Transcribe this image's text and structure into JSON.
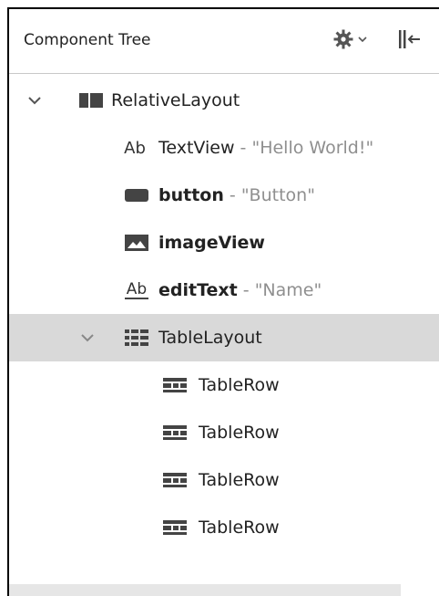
{
  "header": {
    "title": "Component Tree"
  },
  "tree": {
    "relative_layout": {
      "name": "RelativeLayout"
    },
    "text_view": {
      "name": "TextView",
      "sep": " - ",
      "value": "\"Hello World!\"",
      "icon_text": "Ab"
    },
    "button": {
      "name": "button",
      "sep": " - ",
      "value": "\"Button\""
    },
    "image_view": {
      "name": "imageView"
    },
    "edit_text": {
      "name": "editText",
      "sep": " - ",
      "value": "\"Name\"",
      "icon_text": "Ab"
    },
    "table_layout": {
      "name": "TableLayout"
    },
    "table_rows": [
      {
        "name": "TableRow"
      },
      {
        "name": "TableRow"
      },
      {
        "name": "TableRow"
      },
      {
        "name": "TableRow"
      }
    ]
  }
}
